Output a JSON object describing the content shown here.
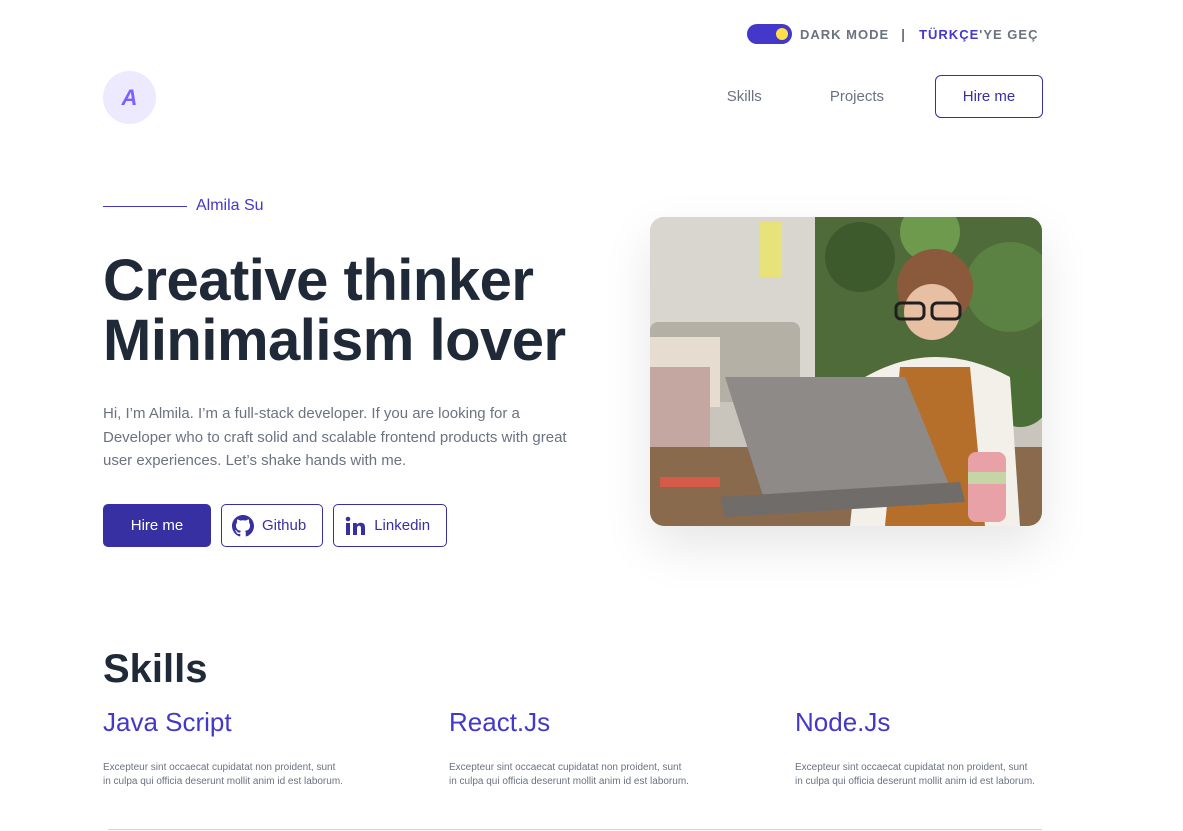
{
  "topbar": {
    "dark_mode_label": "DARK MODE",
    "separator": "|",
    "lang_accent": "TÜRKÇE",
    "lang_rest": "'YE GEÇ"
  },
  "logo": {
    "letter": "A"
  },
  "nav": {
    "items": [
      "Skills",
      "Projects"
    ],
    "hire_label": "Hire me"
  },
  "hero": {
    "eyebrow": "Almila Su",
    "headline_line1": "Creative thinker",
    "headline_line2": "Minimalism lover",
    "intro": "Hi, I’m Almila. I’m a full-stack developer. If you are looking for a Developer who to craft solid and scalable frontend products with great user experiences. Let’s shake hands with me.",
    "hire_label": "Hire me",
    "github_label": "Github",
    "linkedin_label": "Linkedin"
  },
  "skills": {
    "title": "Skills",
    "items": [
      {
        "name": "Java Script",
        "desc": "Excepteur sint occaecat cupidatat non proident, sunt in culpa qui officia deserunt mollit anim id est laborum."
      },
      {
        "name": "React.Js",
        "desc": "Excepteur sint occaecat cupidatat non proident, sunt in culpa qui officia deserunt mollit anim id est laborum."
      },
      {
        "name": "Node.Js",
        "desc": "Excepteur sint occaecat cupidatat non proident, sunt in culpa qui officia deserunt mollit anim id est laborum."
      }
    ]
  },
  "colors": {
    "accent": "#4338ca",
    "primary_button": "#3730a3",
    "heading": "#1f2937",
    "muted": "#6b7280",
    "toggle_knob": "#fde047"
  },
  "icons": [
    "dark-mode-toggle",
    "github-icon",
    "linkedin-icon"
  ]
}
